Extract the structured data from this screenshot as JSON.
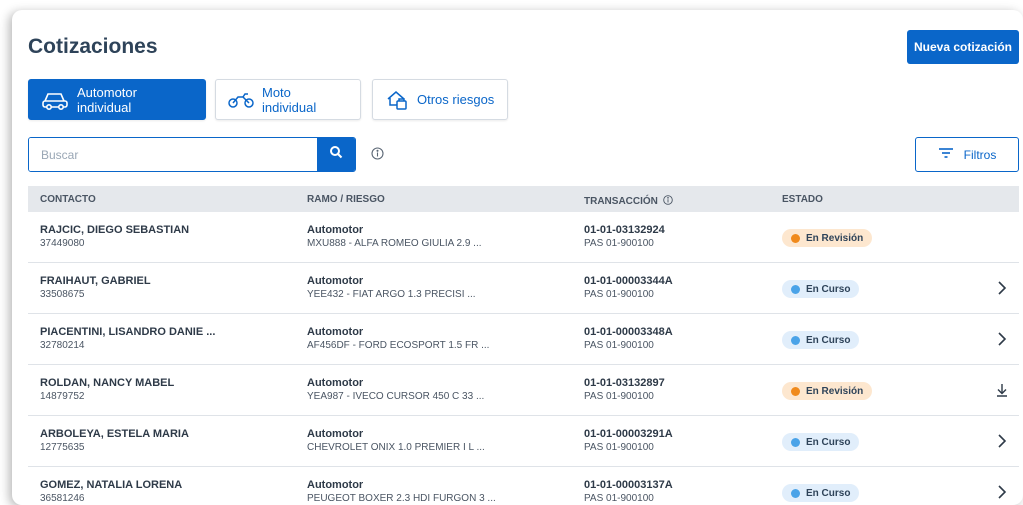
{
  "page": {
    "title": "Cotizaciones",
    "new_button": "Nueva cotización"
  },
  "tabs": [
    {
      "label": "Automotor individual",
      "icon": "car-icon",
      "active": true
    },
    {
      "label": "Moto individual",
      "icon": "motorcycle-icon",
      "active": false
    },
    {
      "label": "Otros riesgos",
      "icon": "home-risk-icon",
      "active": false
    }
  ],
  "search": {
    "placeholder": "Buscar",
    "value": ""
  },
  "filters": {
    "label": "Filtros"
  },
  "table": {
    "headers": {
      "contact": "CONTACTO",
      "branch": "RAMO / RIESGO",
      "transaction": "TRANSACCIÓN",
      "status": "ESTADO"
    },
    "rows": [
      {
        "name": "RAJCIC, DIEGO SEBASTIAN",
        "id": "37449080",
        "branch": "Automotor",
        "risk": "MXU888 - ALFA ROMEO GIULIA 2.9 ...",
        "transaction": "01-01-03132924",
        "pas": "PAS 01-900100",
        "status": "En Revisión",
        "status_type": "review",
        "action": "none"
      },
      {
        "name": "FRAIHAUT, GABRIEL",
        "id": "33508675",
        "branch": "Automotor",
        "risk": "YEE432 - FIAT ARGO 1.3 PRECISI ...",
        "transaction": "01-01-00003344A",
        "pas": "PAS 01-900100",
        "status": "En Curso",
        "status_type": "progress",
        "action": "chevron"
      },
      {
        "name": "PIACENTINI, LISANDRO DANIE ...",
        "id": "32780214",
        "branch": "Automotor",
        "risk": "AF456DF - FORD ECOSPORT 1.5 FR ...",
        "transaction": "01-01-00003348A",
        "pas": "PAS 01-900100",
        "status": "En Curso",
        "status_type": "progress",
        "action": "chevron"
      },
      {
        "name": "ROLDAN, NANCY MABEL",
        "id": "14879752",
        "branch": "Automotor",
        "risk": "YEA987 - IVECO CURSOR 450 C 33 ...",
        "transaction": "01-01-03132897",
        "pas": "PAS 01-900100",
        "status": "En Revisión",
        "status_type": "review",
        "action": "download"
      },
      {
        "name": "ARBOLEYA, ESTELA MARIA",
        "id": "12775635",
        "branch": "Automotor",
        "risk": "CHEVROLET ONIX 1.0 PREMIER I L ...",
        "transaction": "01-01-00003291A",
        "pas": "PAS 01-900100",
        "status": "En Curso",
        "status_type": "progress",
        "action": "chevron"
      },
      {
        "name": "GOMEZ, NATALIA LORENA",
        "id": "36581246",
        "branch": "Automotor",
        "risk": "PEUGEOT BOXER 2.3 HDI FURGON 3 ...",
        "transaction": "01-01-00003137A",
        "pas": "PAS 01-900100",
        "status": "En Curso",
        "status_type": "progress",
        "action": "chevron"
      }
    ]
  },
  "colors": {
    "primary": "#0a66c9",
    "title": "#2e4359",
    "review_badge_bg": "#fde7cf",
    "review_dot": "#f08a1c",
    "progress_badge_bg": "#e1eefb",
    "progress_dot": "#4aa3e8"
  }
}
